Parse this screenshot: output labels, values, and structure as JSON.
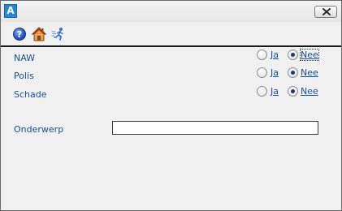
{
  "window": {
    "app_icon_letter": "A",
    "close_label": "×"
  },
  "toolbar": {
    "help_icon": "help-icon",
    "home_icon": "home-icon",
    "run_icon": "running-person-icon"
  },
  "form": {
    "rows": [
      {
        "label": "NAW",
        "option_yes": "Ja",
        "option_no": "Nee",
        "selected": "Nee"
      },
      {
        "label": "Polis",
        "option_yes": "Ja",
        "option_no": "Nee",
        "selected": "Nee"
      },
      {
        "label": "Schade",
        "option_yes": "Ja",
        "option_no": "Nee",
        "selected": "Nee"
      }
    ],
    "subject_label": "Onderwerp",
    "subject_value": ""
  },
  "colors": {
    "label_text": "#1c4f8f",
    "app_icon_bg": "#1f88d8",
    "window_bg": "#f0f0f0"
  }
}
